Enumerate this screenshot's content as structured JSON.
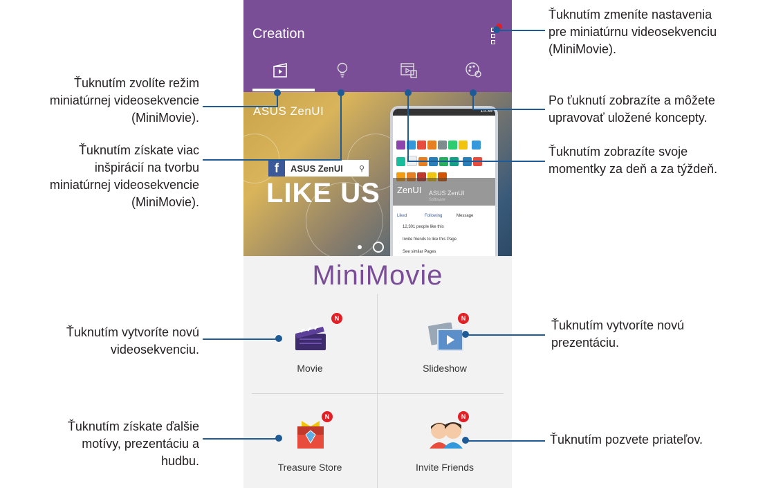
{
  "app": {
    "title": "Creation"
  },
  "banner": {
    "brand": "ASUS ZenUI",
    "fb_search": "ASUS ZenUI",
    "headline": "LIKE US",
    "mock_brand": "ZenUI",
    "mock_lines": [
      "ASUS ZenUI",
      "Software",
      "Liked",
      "Following",
      "Message",
      "12,301 people like this",
      "Invite friends to like this Page",
      "See similar Pages"
    ],
    "status_time": "15:39"
  },
  "section_title": "MiniMovie",
  "tiles": [
    {
      "label": "Movie",
      "badge": "N"
    },
    {
      "label": "Slideshow",
      "badge": "N"
    },
    {
      "label": "Treasure Store",
      "badge": "N"
    },
    {
      "label": "Invite Friends",
      "badge": "N"
    }
  ],
  "callouts": {
    "settings": [
      "Ťuknutím zmeníte nastavenia",
      "pre miniatúrnu videosekvenciu",
      "(MiniMovie)."
    ],
    "mode": [
      "Ťuknutím zvolíte režim",
      "miniatúrnej videosekvencie",
      "(MiniMovie)."
    ],
    "drafts": [
      "Po ťuknutí zobrazíte a môžete",
      "upravovať uložené koncepty."
    ],
    "inspiration": [
      "Ťuknutím získate viac",
      "inšpirácií na tvorbu",
      "miniatúrnej videosekvencie",
      "(MiniMovie)."
    ],
    "moments": [
      "Ťuknutím zobrazíte svoje",
      "momentky za deň a za týždeň."
    ],
    "new_video": [
      "Ťuknutím vytvoríte novú",
      "videosekvenciu."
    ],
    "new_slideshow": [
      "Ťuknutím vytvoríte novú",
      "prezentáciu."
    ],
    "more_themes": [
      "Ťuknutím získate ďalšie",
      "motívy, prezentáciu a",
      "hudbu."
    ],
    "invite": [
      "Ťuknutím pozvete priateľov."
    ]
  },
  "colors": {
    "appbar": "#7a4e97",
    "leader": "#1e5a96",
    "badge": "#e31f26"
  }
}
